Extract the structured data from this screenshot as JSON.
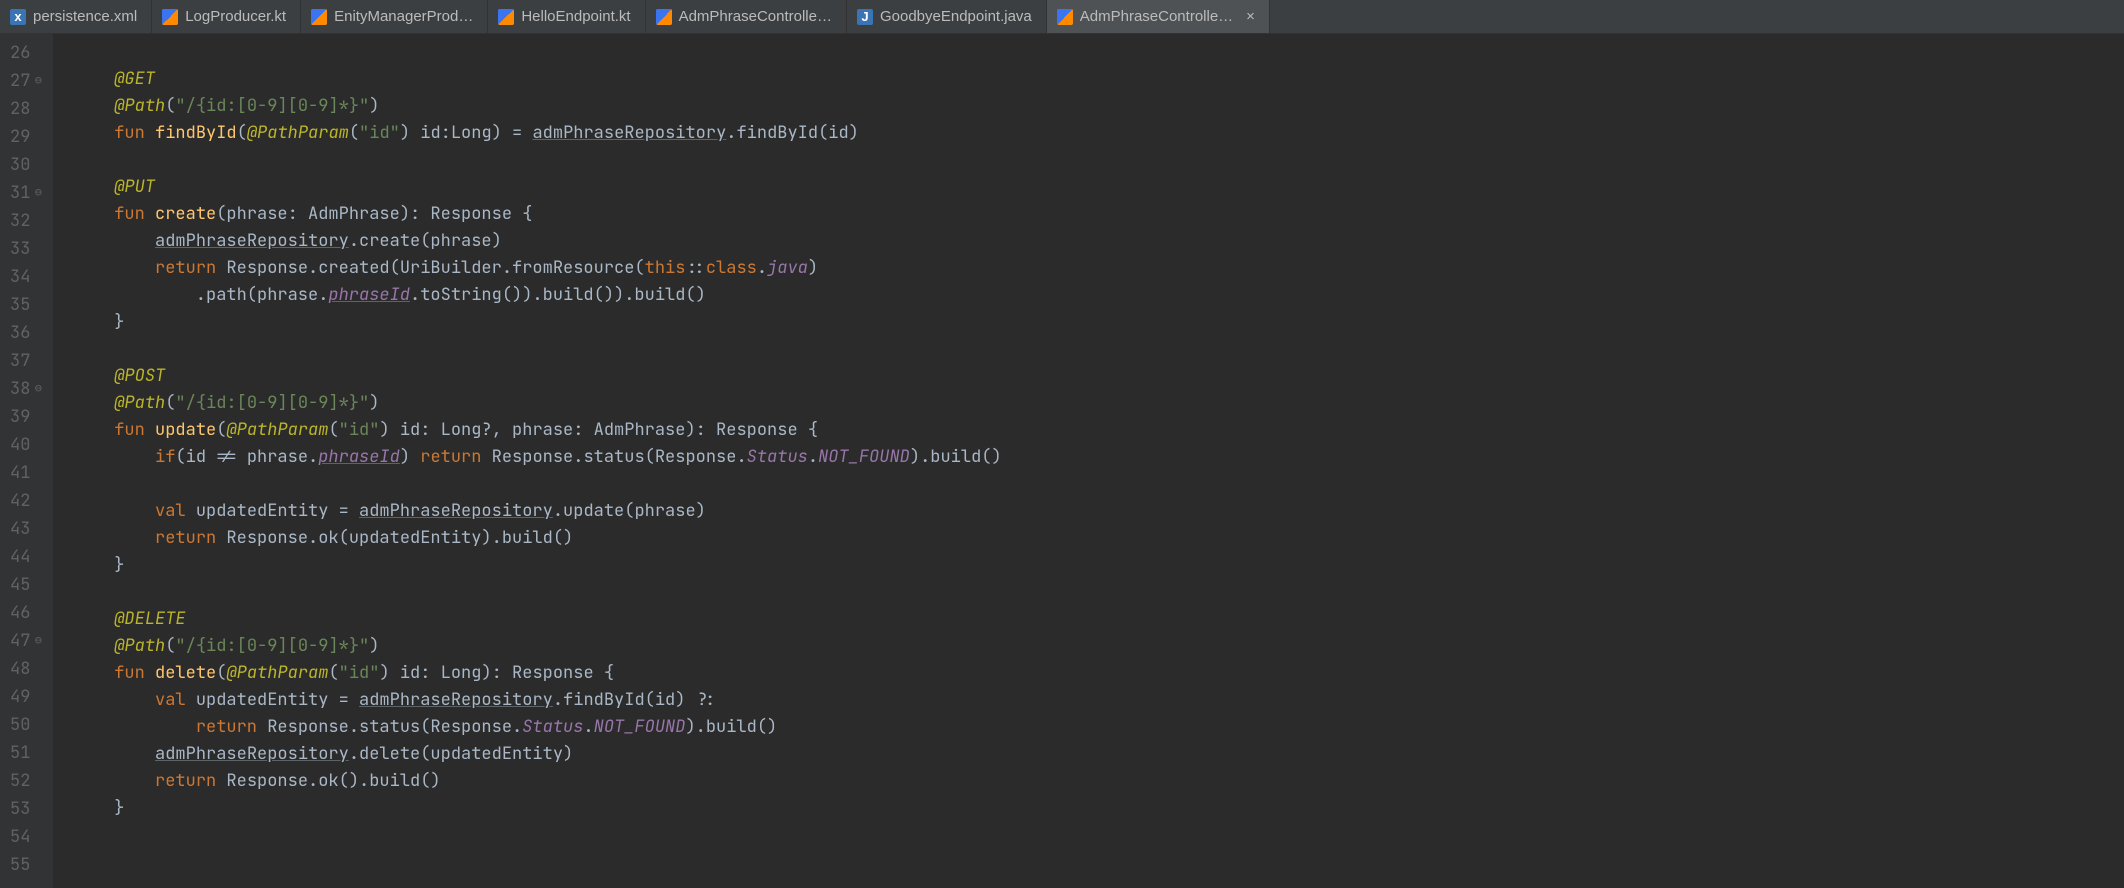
{
  "tabs": [
    {
      "label": "persistence.xml",
      "icon": "xml",
      "active": false
    },
    {
      "label": "LogProducer.kt",
      "icon": "kt",
      "active": false
    },
    {
      "label": "EnityManagerProd…",
      "icon": "kt",
      "active": false
    },
    {
      "label": "HelloEndpoint.kt",
      "icon": "kt",
      "active": false
    },
    {
      "label": "AdmPhraseControlle…",
      "icon": "kt",
      "active": false
    },
    {
      "label": "GoodbyeEndpoint.java",
      "icon": "java",
      "active": false
    },
    {
      "label": "AdmPhraseControlle…",
      "icon": "kt",
      "active": true,
      "closable": true
    }
  ],
  "close_glyph": "×",
  "gutter": {
    "lines": [
      {
        "n": "26"
      },
      {
        "n": "27",
        "fold": true
      },
      {
        "n": "28"
      },
      {
        "n": "29"
      },
      {
        "n": "30"
      },
      {
        "n": "31",
        "fold": true
      },
      {
        "n": "32"
      },
      {
        "n": "33"
      },
      {
        "n": "34"
      },
      {
        "n": "35"
      },
      {
        "n": "36"
      },
      {
        "n": "37"
      },
      {
        "n": "38",
        "fold": true
      },
      {
        "n": "39"
      },
      {
        "n": "40"
      },
      {
        "n": "41"
      },
      {
        "n": "42"
      },
      {
        "n": "43"
      },
      {
        "n": "44"
      },
      {
        "n": "45"
      },
      {
        "n": "46"
      },
      {
        "n": "47",
        "fold": true
      },
      {
        "n": "48"
      },
      {
        "n": "49"
      },
      {
        "n": "50"
      },
      {
        "n": "51"
      },
      {
        "n": "52"
      },
      {
        "n": "53"
      },
      {
        "n": "54"
      },
      {
        "n": "55"
      }
    ],
    "fold_glyph": "⊖"
  },
  "code": {
    "ann_get": "@GET",
    "ann_put": "@PUT",
    "ann_post": "@POST",
    "ann_delete": "@DELETE",
    "ann_path": "@Path",
    "ann_pathparam": "@PathParam",
    "path_pattern": "\"/{id:[0-9][0-9]*}\"",
    "id_str": "\"id\"",
    "kw_fun": "fun",
    "kw_return": "return",
    "kw_val": "val",
    "kw_if": "if",
    "kw_this": "this",
    "kw_class": "class",
    "fn_findById": "findById",
    "fn_create": "create",
    "fn_update": "update",
    "fn_delete": "delete",
    "id_id": "id",
    "typ_Long": "Long",
    "typ_LongOpt": "Long?",
    "typ_Response": "Response",
    "typ_AdmPhrase": "AdmPhrase",
    "typ_UriBuilder": "UriBuilder",
    "id_phrase": "phrase",
    "id_updatedEntity": "updatedEntity",
    "repo": "admPhraseRepository",
    "m_findById": "findById",
    "m_create": "create",
    "m_created": "created",
    "m_fromResource": "fromResource",
    "m_path": "path",
    "m_toString": "toString",
    "m_build": "build",
    "m_status": "status",
    "m_update": "update",
    "m_ok": "ok",
    "m_delete": "delete",
    "prop_java": "java",
    "prop_phraseId": "phraseId",
    "prop_Status": "Status",
    "const_NOT_FOUND": "NOT_FOUND",
    "neq": "!=",
    "elvis": "?:"
  }
}
